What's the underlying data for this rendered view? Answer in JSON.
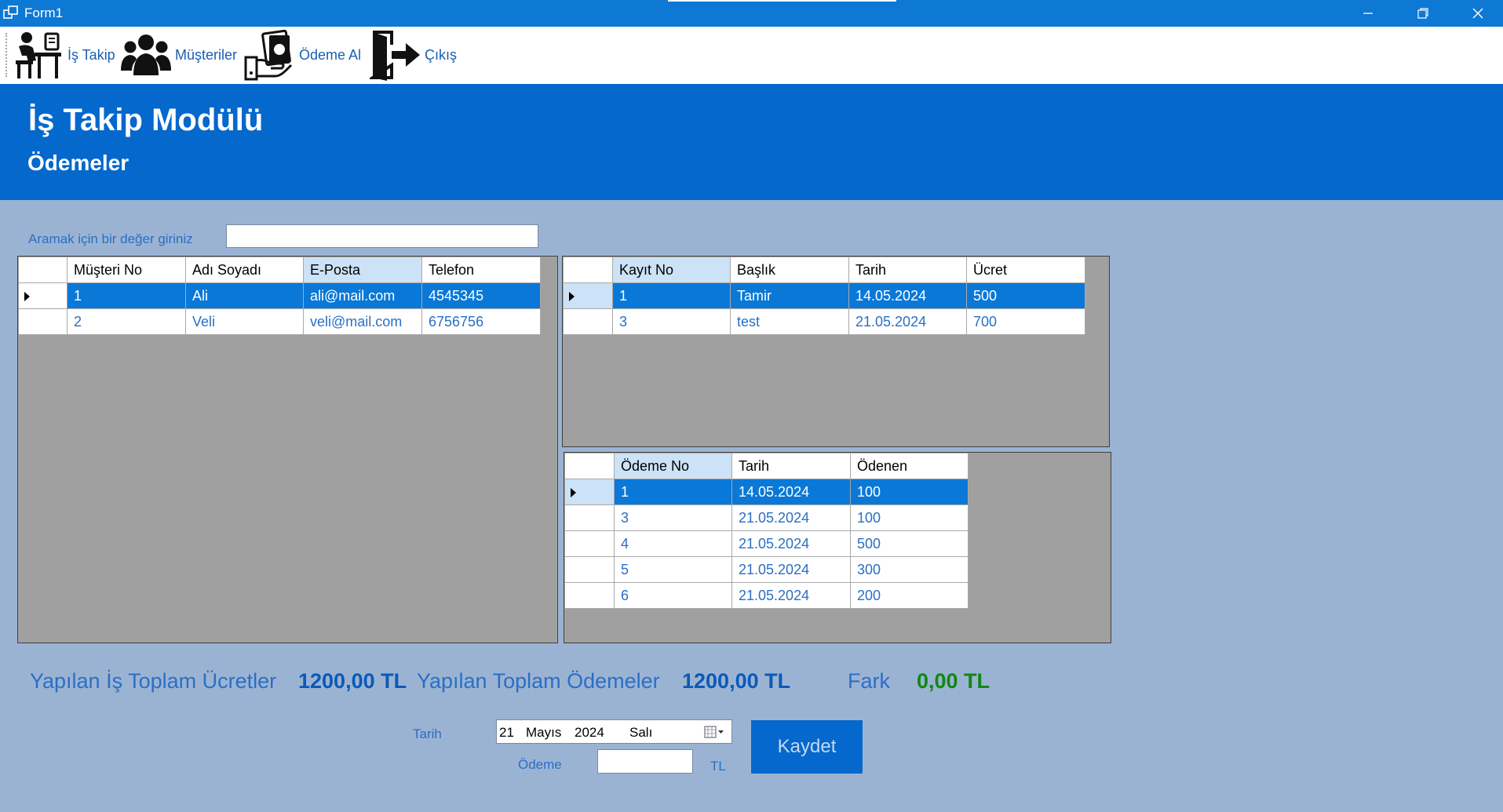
{
  "window": {
    "title": "Form1"
  },
  "toolbar": {
    "items": [
      {
        "label": "İş Takip",
        "icon": "worker-desk-icon"
      },
      {
        "label": "Müşteriler",
        "icon": "users-group-icon"
      },
      {
        "label": "Ödeme Al",
        "icon": "payment-cash-icon"
      },
      {
        "label": "Çıkış",
        "icon": "exit-door-icon"
      }
    ]
  },
  "header": {
    "title": "İş Takip Modülü",
    "subtitle": "Ödemeler"
  },
  "search": {
    "label": "Aramak için bir değer giriniz",
    "value": ""
  },
  "customers_grid": {
    "columns": [
      "Müşteri No",
      "Adı Soyadı",
      "E-Posta",
      "Telefon"
    ],
    "rows": [
      [
        "1",
        "Ali",
        "ali@mail.com",
        "4545345"
      ],
      [
        "2",
        "Veli",
        "veli@mail.com",
        "6756756"
      ]
    ]
  },
  "jobs_grid": {
    "columns": [
      "Kayıt No",
      "Başlık",
      "Tarih",
      "Ücret"
    ],
    "rows": [
      [
        "1",
        "Tamir",
        "14.05.2024",
        "500"
      ],
      [
        "3",
        "test",
        "21.05.2024",
        "700"
      ]
    ]
  },
  "payments_grid": {
    "columns": [
      "Ödeme No",
      "Tarih",
      "Ödenen"
    ],
    "rows": [
      [
        "1",
        "14.05.2024",
        "100"
      ],
      [
        "3",
        "21.05.2024",
        "100"
      ],
      [
        "4",
        "21.05.2024",
        "500"
      ],
      [
        "5",
        "21.05.2024",
        "300"
      ],
      [
        "6",
        "21.05.2024",
        "200"
      ]
    ]
  },
  "totals": {
    "fees_label": "Yapılan İş Toplam Ücretler",
    "fees_value": "1200,00 TL",
    "payments_label": "Yapılan Toplam Ödemeler",
    "payments_value": "1200,00 TL",
    "diff_label": "Fark",
    "diff_value": "0,00 TL"
  },
  "form": {
    "date_label": "Tarih",
    "date_day": "21",
    "date_month": "Mayıs",
    "date_year": "2024",
    "date_weekday": "Salı",
    "payment_label": "Ödeme",
    "payment_value": "",
    "currency": "TL",
    "save_label": "Kaydet"
  },
  "colors": {
    "accent": "#0468cc",
    "background": "#9bb3d3",
    "selection": "#0a78d7",
    "positive": "#108810"
  }
}
